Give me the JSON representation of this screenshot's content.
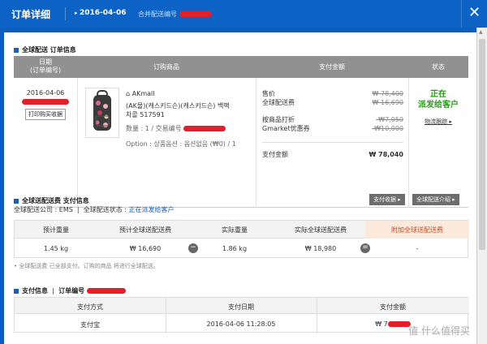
{
  "window": {
    "title": "订单详细",
    "date": "2016-04-06",
    "shipping_prefix": "合并配送编号",
    "close_label": "✕"
  },
  "order_section": {
    "title": "全球配送 订单信息",
    "headers": {
      "date_line1": "日期",
      "date_line2": "(订单编号)",
      "product": "订购商品",
      "payment": "支付金额",
      "status": "状态"
    },
    "order_date": "2016-04-06",
    "print_button": "打印购买收据",
    "seller": "AKmall",
    "product_name_line1": "(AK몰)(캐스키드슨)(캐스키드슨) 백팩",
    "product_name_line2": "차콜 517591",
    "quantity_label": "数量 : 1 / 交易编号",
    "option_label": "Option : 상품옵션 : 옵션없음 (₩0) / 1",
    "price_label": "售价",
    "price_value": "₩ 78,400",
    "shipping_label": "全球配送费",
    "shipping_value": "₩ 16,690",
    "discount_label": "按商品打折",
    "discount_value": "-₩7,050",
    "coupon_label": "Gmarket优惠券",
    "coupon_value": "-₩10,000",
    "total_label": "支付金额",
    "total_value": "₩ 78,040",
    "status_line1": "正在",
    "status_line2": "派发给客户",
    "track_link": "物流跟踪",
    "colors": {
      "status_green": "#2a9a1a",
      "header_gray": "#919191",
      "brand_blue": "#0d62c5"
    }
  },
  "shipping_section": {
    "title": "全球送配送费 支付信息",
    "company_label": "全球配送公司 : EMS",
    "status_label": "全球配送状态 : ",
    "status_value": "正在派发给客户",
    "receipt_button": "支付收据",
    "intro_button": "全球配送介绍",
    "headers": [
      "预计重量",
      "预计全球送配送费",
      "实际重量",
      "实际全球送配送费",
      "附加全球送配送费"
    ],
    "values": [
      "1.45 kg",
      "₩ 16,690",
      "1.86 kg",
      "₩ 18,980",
      "-"
    ],
    "minus_icon": "−",
    "equals_icon": "=",
    "note": "• 全球配送费 已全部支付。订购的商品 将进行全球配送。"
  },
  "payment_section": {
    "title": "支付信息",
    "order_no_label": "订单编号",
    "headers": [
      "支付方式",
      "支付日期",
      "支付金额"
    ],
    "values": [
      "支付宝",
      "2016-04-06 11:28:05",
      "₩ 7"
    ]
  },
  "watermark": "值 什么值得买"
}
